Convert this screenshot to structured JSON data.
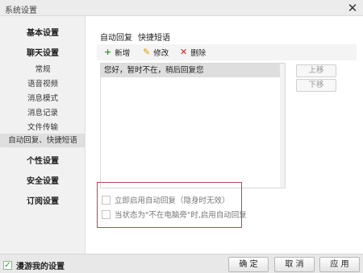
{
  "window": {
    "title": "系统设置",
    "close_glyph": "✕"
  },
  "sidebar": {
    "basic": "基本设置",
    "chat": "聊天设置",
    "chat_items": [
      "常规",
      "语音视频",
      "消息模式",
      "消息记录",
      "文件传输",
      "自动回复、快捷短语"
    ],
    "personal": "个性设置",
    "security": "安全设置",
    "subscription": "订阅设置"
  },
  "tabs": {
    "auto_reply": "自动回复",
    "quick_phrase": "快捷短语"
  },
  "toolbar": {
    "add": "新增",
    "edit": "修改",
    "delete": "删除"
  },
  "reply_list": {
    "items": [
      "您好，暂时不在，稍后回复您"
    ]
  },
  "side_buttons": {
    "up": "上移",
    "down": "下移"
  },
  "options": {
    "enable_now": "立即启用自动回复（隐身时无效）",
    "away_enable": "当状态为\"不在电脑旁\"时,启用自动回复"
  },
  "bottom": {
    "roam": "漫游我的设置",
    "ok": "确 定",
    "cancel": "取 消",
    "apply": "应 用"
  },
  "colors": {
    "add_icon": "#2e9e2e",
    "edit_icon": "#e0a000",
    "delete_icon": "#d02020",
    "highlight_box": "#b44a4a"
  }
}
